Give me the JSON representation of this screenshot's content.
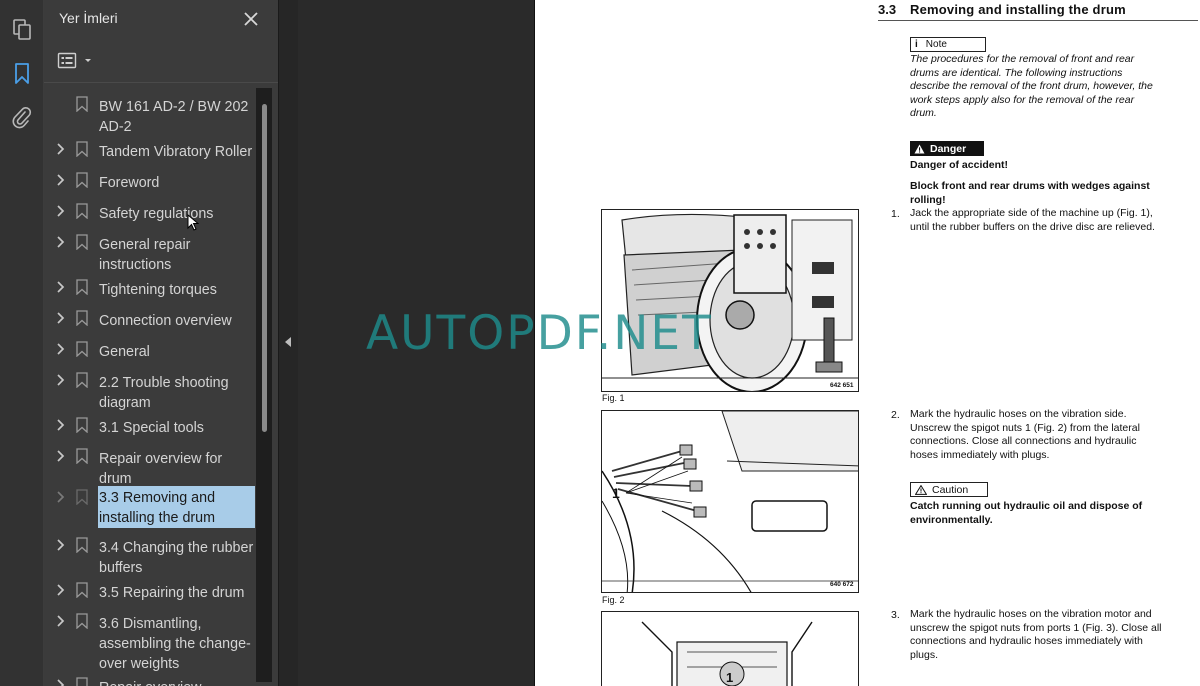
{
  "colors": {
    "panel_bg": "#3b3b3b",
    "selected_highlight": "#a8cce8",
    "icon_active": "#4a9fe8",
    "watermark": "#1e8c8c"
  },
  "rail": {
    "icons": [
      "pages-icon",
      "bookmark-icon",
      "attachment-icon"
    ]
  },
  "panel": {
    "title": "Yer İmleri",
    "items": [
      {
        "label": "BW 161 AD-2 / BW 202 AD-2",
        "has_children": false
      },
      {
        "label": "Tandem Vibratory Roller",
        "has_children": true
      },
      {
        "label": "Foreword",
        "has_children": true
      },
      {
        "label": "Safety regulations",
        "has_children": true
      },
      {
        "label": "General repair instructions",
        "has_children": true
      },
      {
        "label": "Tightening torques",
        "has_children": true
      },
      {
        "label": "Connection overview",
        "has_children": true
      },
      {
        "label": "General",
        "has_children": true
      },
      {
        "label": "2.2 Trouble shooting diagram",
        "has_children": true
      },
      {
        "label": "3.1 Special tools",
        "has_children": true
      },
      {
        "label": "Repair overview for drum",
        "has_children": true
      },
      {
        "label": "3.3 Removing and installing the drum",
        "has_children": true,
        "selected": true
      },
      {
        "label": "3.4 Changing the rubber buffers",
        "has_children": true
      },
      {
        "label": "3.5 Repairing the drum",
        "has_children": true
      },
      {
        "label": "3.6 Dismantling, assembling the change-over weights",
        "has_children": true
      },
      {
        "label": "Repair overview",
        "has_children": true
      }
    ]
  },
  "document": {
    "section_number": "3.3",
    "section_title": "Removing and installing the drum",
    "note": {
      "label": "Note",
      "text": "The procedures for the removal of front and rear drums are identical. The following instructions describe the removal of the front drum, however, the work steps apply also for the removal of the rear drum."
    },
    "danger": {
      "label": "Danger",
      "line1": "Danger of accident!",
      "line2": "Block front and rear drums with wedges against rolling!"
    },
    "steps": [
      {
        "num": "1.",
        "text": "Jack the appropriate side of the machine up (Fig. 1), until the rubber buffers on the drive disc are relieved."
      },
      {
        "num": "2.",
        "text": "Mark the hydraulic hoses on the vibration side. Unscrew the spigot nuts 1 (Fig. 2) from the lateral connections. Close all connections and hydraulic hoses immediately with plugs."
      },
      {
        "num": "3.",
        "text": "Mark the hydraulic hoses on the vibration motor and unscrew the spigot nuts from ports 1 (Fig. 3). Close all connections and hydraulic hoses immediately with plugs."
      }
    ],
    "caution": {
      "label": "Caution",
      "text": "Catch running out hydraulic oil and dispose of environmentally."
    },
    "figures": [
      {
        "caption": "Fig. 1",
        "code": "642 651"
      },
      {
        "caption": "Fig. 2",
        "code": "640 672",
        "callout": "1"
      },
      {
        "code": "",
        "callout": "1"
      }
    ]
  },
  "watermark": "AUTOPDF.NET"
}
